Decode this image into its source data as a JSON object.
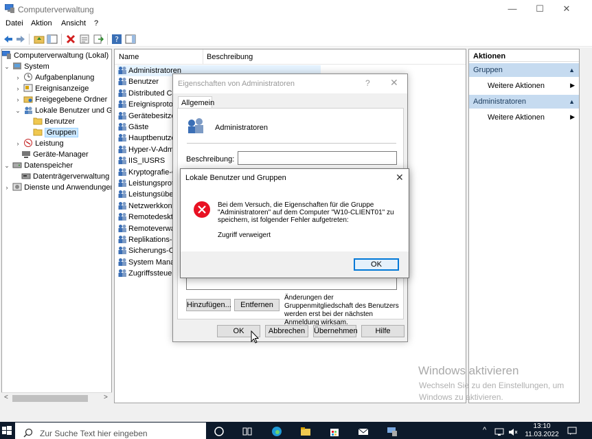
{
  "window": {
    "title": "Computerverwaltung",
    "min": "—",
    "max": "☐",
    "close": "✕"
  },
  "menu": [
    "Datei",
    "Aktion",
    "Ansicht",
    "?"
  ],
  "tree": [
    {
      "label": "Computerverwaltung (Lokal)",
      "arrow": "",
      "icon": "computer-management-icon"
    },
    {
      "label": "System",
      "arrow": "⌄",
      "icon": "system-tools-icon"
    },
    {
      "label": "Aufgabenplanung",
      "arrow": "›",
      "icon": "task-scheduler-icon"
    },
    {
      "label": "Ereignisanzeige",
      "arrow": "›",
      "icon": "event-viewer-icon"
    },
    {
      "label": "Freigegebene Ordner",
      "arrow": "›",
      "icon": "shared-folder-icon"
    },
    {
      "label": "Lokale Benutzer und Gruppen",
      "arrow": "⌄",
      "icon": "users-groups-icon"
    },
    {
      "label": "Benutzer",
      "arrow": "",
      "icon": "folder-icon"
    },
    {
      "label": "Gruppen",
      "arrow": "",
      "icon": "folder-open-icon"
    },
    {
      "label": "Leistung",
      "arrow": "›",
      "icon": "performance-icon"
    },
    {
      "label": "Geräte-Manager",
      "arrow": "",
      "icon": "device-manager-icon"
    },
    {
      "label": "Datenspeicher",
      "arrow": "⌄",
      "icon": "storage-icon"
    },
    {
      "label": "Datenträgerverwaltung",
      "arrow": "",
      "icon": "disk-management-icon"
    },
    {
      "label": "Dienste und Anwendungen",
      "arrow": "›",
      "icon": "services-icon"
    }
  ],
  "list": {
    "columns": [
      "Name",
      "Beschreibung"
    ],
    "rows": [
      "Administratoren",
      "Benutzer",
      "Distributed CO",
      "Ereignisprotok",
      "Gerätebesitzer",
      "Gäste",
      "Hauptbenutze",
      "Hyper-V-Adm",
      "IIS_IUSRS",
      "Kryptografie-O",
      "Leistungsproto",
      "Leistungsüber",
      "Netzwerkkonfi",
      "Remotedeskto",
      "Remoteverwalt",
      "Replikations-O",
      "Sicherungs-Op",
      "System Manag",
      "Zugriffssteuer"
    ]
  },
  "actions": {
    "header": "Aktionen",
    "sections": [
      {
        "title": "Gruppen",
        "item": "Weitere Aktionen"
      },
      {
        "title": "Administratoren",
        "item": "Weitere Aktionen"
      }
    ]
  },
  "watermark": {
    "title": "Windows aktivieren",
    "line1": "Wechseln Sie zu den Einstellungen, um",
    "line2": "Windows zu aktivieren."
  },
  "properties": {
    "title": "Eigenschaften von Administratoren",
    "help": "?",
    "close": "✕",
    "tab": "Allgemein",
    "group_name": "Administratoren",
    "desc_label": "Beschreibung:",
    "add": "Hinzufügen...",
    "remove": "Entfernen",
    "note": "Änderungen der Gruppenmitgliedschaft des Benutzers werden erst bei der nächsten Anmeldung wirksam.",
    "ok": "OK",
    "cancel": "Abbrechen",
    "apply": "Übernehmen",
    "helpbtn": "Hilfe"
  },
  "error": {
    "title": "Lokale Benutzer und Gruppen",
    "close": "✕",
    "message": "Bei dem Versuch, die Eigenschaften für die Gruppe \"Administratoren\" auf dem Computer \"W10-CLIENT01\" zu speichern, ist folgender Fehler aufgetreten:",
    "detail": "Zugriff verweigert",
    "ok": "OK"
  },
  "taskbar": {
    "search_placeholder": "Zur Suche Text hier eingeben",
    "time": "13:10",
    "date": "11.03.2022"
  },
  "colors": {
    "selection": "#cce8ff",
    "action_section": "#c6dbf0",
    "taskbar": "#0d1a2b",
    "error_red": "#e81123",
    "accent": "#0078d7"
  }
}
